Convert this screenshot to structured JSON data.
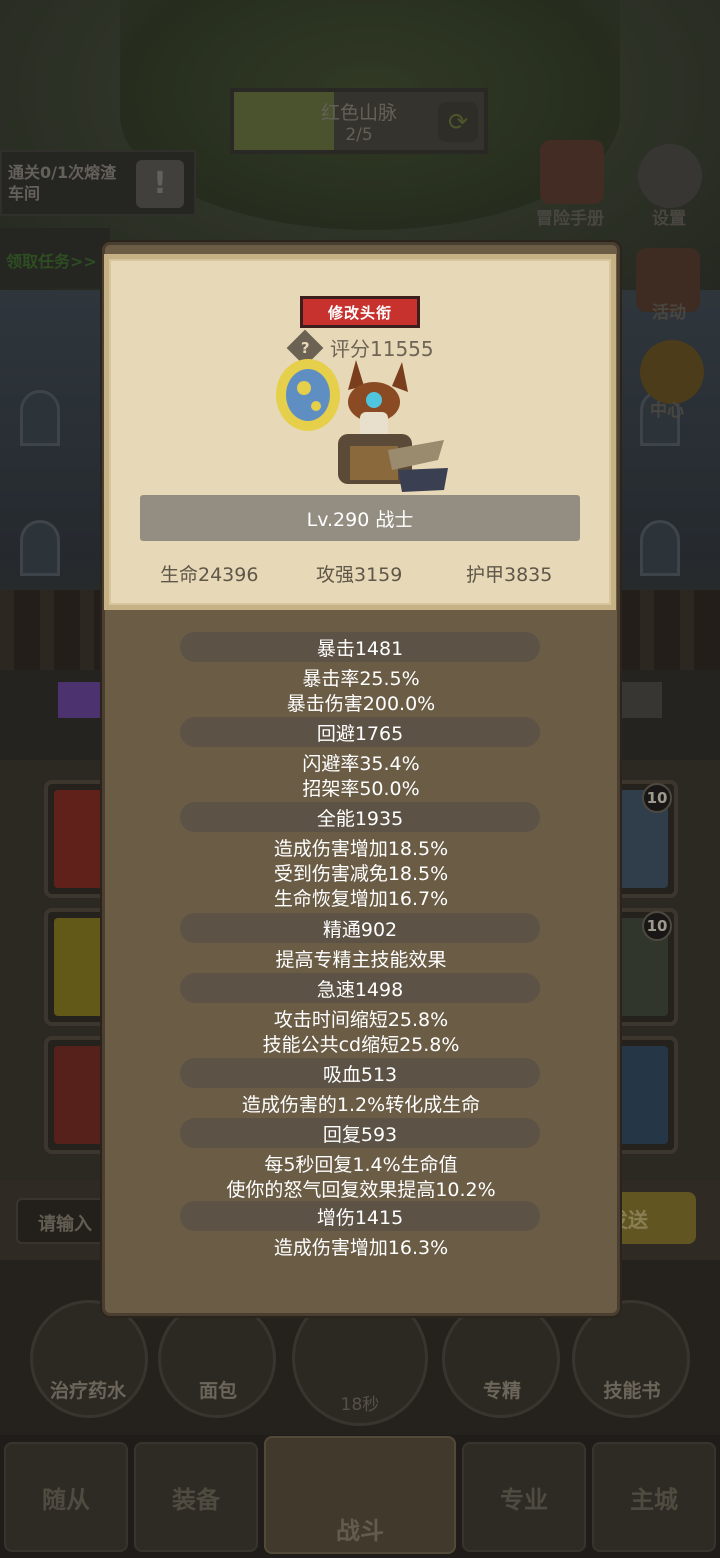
{
  "hud": {
    "map_name": "红色山脉",
    "map_progress": "2/5",
    "map_progress_fraction": 0.4,
    "quest_text": "通关0/1次熔渣车间",
    "quest_claim": "领取任务>>",
    "icon_handbook_label": "冒险手册",
    "icon_settings_label": "设置",
    "icon_event_label": "活动",
    "icon_coin_label": "中心"
  },
  "panel": {
    "title_button": "修改头衔",
    "help_icon": "?",
    "score": "评分11555",
    "level_class": "Lv.290 战士",
    "basic": [
      "生命24396",
      "攻强3159",
      "护甲3835"
    ],
    "sections": [
      {
        "head": "暴击1481",
        "lines": [
          "暴击率25.5%",
          "暴击伤害200.0%"
        ]
      },
      {
        "head": "回避1765",
        "lines": [
          "闪避率35.4%",
          "招架率50.0%"
        ]
      },
      {
        "head": "全能1935",
        "lines": [
          "造成伤害增加18.5%",
          "受到伤害减免18.5%",
          "生命恢复增加16.7%"
        ]
      },
      {
        "head": "精通902",
        "lines": [
          "提高专精主技能效果"
        ]
      },
      {
        "head": "急速1498",
        "lines": [
          "攻击时间缩短25.8%",
          "技能公共cd缩短25.8%"
        ]
      },
      {
        "head": "吸血513",
        "lines": [
          "造成伤害的1.2%转化成生命"
        ]
      },
      {
        "head": "回复593",
        "lines": [
          "每5秒回复1.4%生命值",
          "使你的怒气回复效果提高10.2%"
        ]
      },
      {
        "head": "增伤1415",
        "lines": [
          "造成伤害增加16.3%"
        ]
      }
    ]
  },
  "background": {
    "slot_levels": [
      "10",
      "10"
    ],
    "chat_placeholder": "请输入",
    "send_label": "发送",
    "items": [
      "治疗药水",
      "面包",
      "专精",
      "技能书"
    ],
    "chest_timer": "18秒",
    "nav": [
      "随从",
      "装备",
      "战斗",
      "专业",
      "主城"
    ]
  },
  "colors": {
    "panel_bg": "#6b5c46",
    "parchment": "#e7d8b7",
    "title_button": "#c7322f",
    "stat_head": "#5c5245"
  }
}
